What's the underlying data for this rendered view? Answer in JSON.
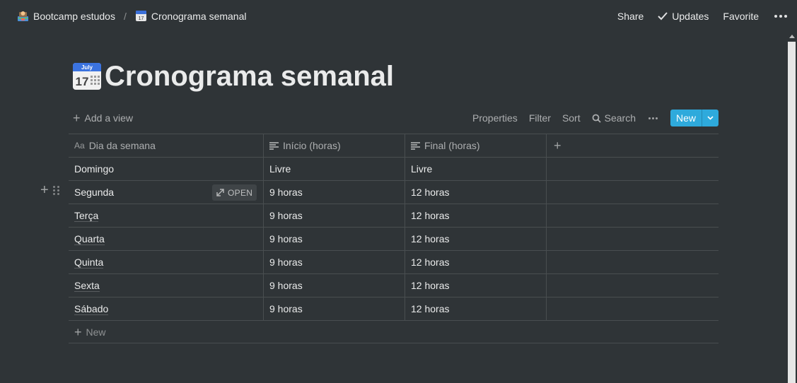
{
  "breadcrumb": {
    "workspace": "Bootcamp estudos",
    "separator": "/",
    "page": "Cronograma semanal"
  },
  "topbar": {
    "share": "Share",
    "updates": "Updates",
    "favorite": "Favorite"
  },
  "page": {
    "title": "Cronograma semanal",
    "icon_month": "July",
    "icon_day": "17"
  },
  "view_bar": {
    "add_view": "Add a view",
    "properties": "Properties",
    "filter": "Filter",
    "sort": "Sort",
    "search": "Search",
    "new": "New"
  },
  "table": {
    "columns": [
      "Dia da semana",
      "Início (horas)",
      "Final (horas)"
    ],
    "rows": [
      {
        "day": "Domingo",
        "start": "Livre",
        "end": "Livre"
      },
      {
        "day": "Segunda",
        "start": "9 horas",
        "end": "12 horas"
      },
      {
        "day": "Terça",
        "start": "9 horas",
        "end": "12 horas"
      },
      {
        "day": "Quarta",
        "start": "9 horas",
        "end": "12 horas"
      },
      {
        "day": "Quinta",
        "start": "9 horas",
        "end": "12 horas"
      },
      {
        "day": "Sexta",
        "start": "9 horas",
        "end": "12 horas"
      },
      {
        "day": "Sábado",
        "start": "9 horas",
        "end": "12 horas"
      }
    ],
    "open_label": "OPEN",
    "new_row": "New"
  },
  "colors": {
    "background": "#2f3437",
    "accent": "#2eaadc"
  }
}
